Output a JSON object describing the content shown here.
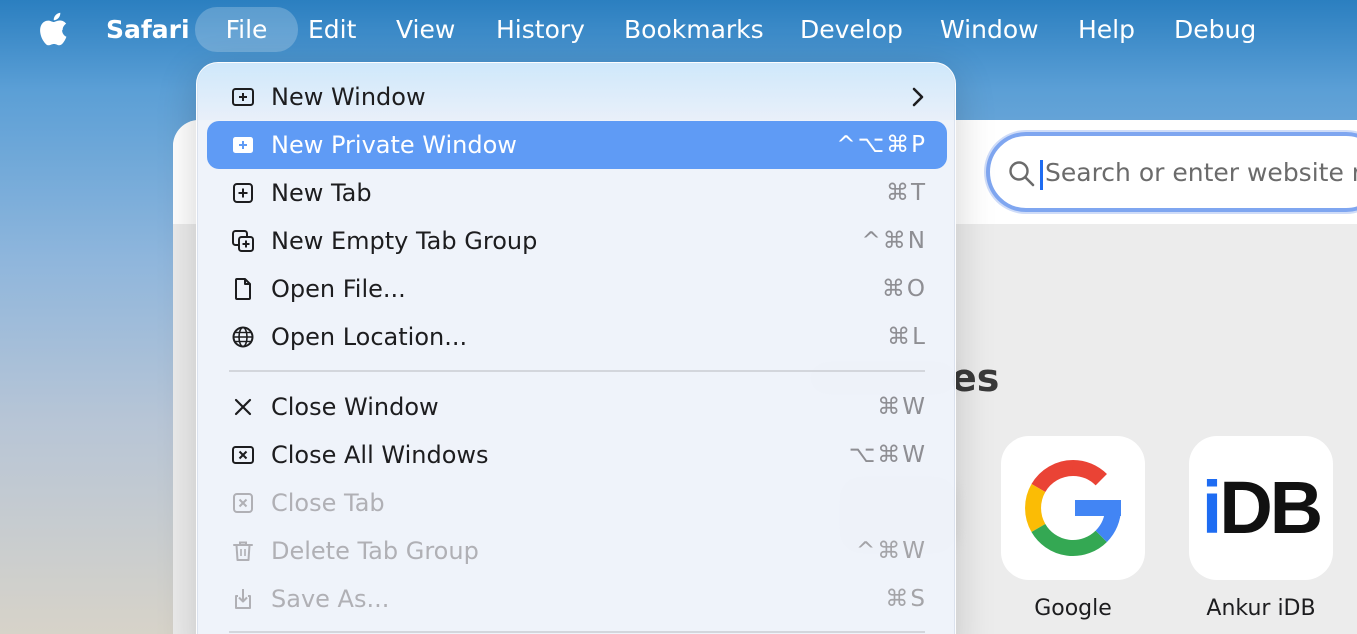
{
  "menubar": {
    "apple_icon": "apple-logo-icon",
    "app_name": "Safari",
    "items": [
      "File",
      "Edit",
      "View",
      "History",
      "Bookmarks",
      "Develop",
      "Window",
      "Help",
      "Debug"
    ],
    "active_item": "File"
  },
  "file_menu": {
    "items": [
      {
        "label": "New Window",
        "shortcut": "",
        "icon": "new-window-icon",
        "submenu": true
      },
      {
        "label": "New Private Window",
        "shortcut": "^⌥⌘P",
        "icon": "new-private-window-icon",
        "highlighted": true
      },
      {
        "label": "New Tab",
        "shortcut": "⌘T",
        "icon": "new-tab-icon"
      },
      {
        "label": "New Empty Tab Group",
        "shortcut": "^⌘N",
        "icon": "new-tab-group-icon"
      },
      {
        "label": "Open File...",
        "shortcut": "⌘O",
        "icon": "document-icon"
      },
      {
        "label": "Open Location...",
        "shortcut": "⌘L",
        "icon": "globe-icon"
      },
      {
        "label": "Close Window",
        "shortcut": "⌘W",
        "icon": "close-icon"
      },
      {
        "label": "Close All Windows",
        "shortcut": "⌥⌘W",
        "icon": "close-all-windows-icon"
      },
      {
        "label": "Close Tab",
        "shortcut": "",
        "icon": "close-tab-icon",
        "disabled": true
      },
      {
        "label": "Delete Tab Group",
        "shortcut": "^⌘W",
        "icon": "trash-icon",
        "disabled": true
      },
      {
        "label": "Save As...",
        "shortcut": "⌘S",
        "icon": "save-icon",
        "disabled": true
      }
    ]
  },
  "browser": {
    "address_placeholder": "Search or enter website name",
    "favorites_heading_visible": "es",
    "favorites": [
      {
        "label": "Google",
        "icon": "google-logo-icon"
      },
      {
        "label": "Ankur iDB",
        "icon_text": "iDB"
      }
    ]
  },
  "colors": {
    "highlight": "#5f9bf5",
    "address_focus_ring": "#7fa6f0",
    "idb_blue": "#1e6cf2",
    "google_blue": "#4285F4",
    "google_red": "#EA4335",
    "google_yellow": "#FBBC05",
    "google_green": "#34A853"
  }
}
